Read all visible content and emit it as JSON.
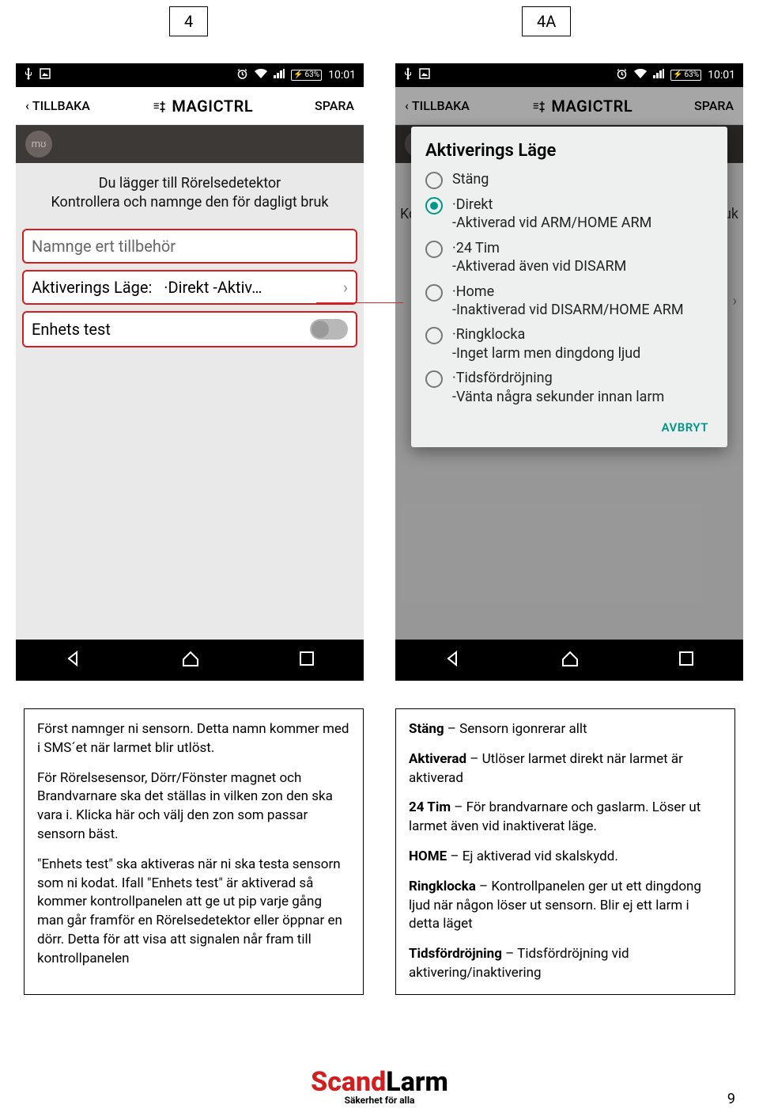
{
  "labels": {
    "left": "4",
    "right": "4A"
  },
  "status": {
    "battery_pct": "63%",
    "time": "10:01"
  },
  "header": {
    "back": "TILLBAKA",
    "brand": "MAGICTRL",
    "save": "SPARA"
  },
  "left_phone": {
    "intro_line1": "Du  lägger till Rörelsedetektor",
    "intro_line2": "Kontrollera och namnge den för dagligt bruk",
    "name_placeholder": "Namnge ert tillbehör",
    "mode_label": "Aktiverings Läge:",
    "mode_value": "·Direkt -Aktiv…",
    "device_test": "Enhets test"
  },
  "dialog": {
    "title": "Aktiverings Läge",
    "options": [
      {
        "top": "",
        "desc": "Stäng",
        "selected": false
      },
      {
        "top": "·Direkt",
        "desc": "-Aktiverad vid ARM/HOME ARM",
        "selected": true
      },
      {
        "top": "·24 Tim",
        "desc": "-Aktiverad även vid DISARM",
        "selected": false
      },
      {
        "top": "·Home",
        "desc": "-Inaktiverad vid DISARM/HOME ARM",
        "selected": false
      },
      {
        "top": "·Ringklocka",
        "desc": "-Inget larm men dingdong ljud",
        "selected": false
      },
      {
        "top": "·Tidsfördröjning",
        "desc": "-Vänta några sekunder innan larm",
        "selected": false
      }
    ],
    "cancel": "AVBRYT"
  },
  "right_peek": {
    "left_text": "Ko",
    "right_text": "uk"
  },
  "info_left": {
    "p1": "Först namnger ni sensorn. Detta namn kommer med i SMS´et när larmet blir utlöst.",
    "p2": "För Rörelsesensor, Dörr/Fönster magnet och Brandvarnare ska det ställas in vilken zon den ska vara i. Klicka här och välj den zon som passar sensorn bäst.",
    "p3": "\"Enhets test\" ska aktiveras när ni ska testa sensorn som ni kodat. Ifall \"Enhets test\" är aktiverad så kommer kontrollpanelen att ge ut pip varje gång man går framför en Rörelsedetektor eller öppnar en dörr. Detta för att visa att signalen når fram till kontrollpanelen"
  },
  "info_right": {
    "i1_k": "Stäng",
    "i1_v": " – Sensorn igonrerar allt",
    "i2_k": "Aktiverad",
    "i2_v": " – Utlöser larmet direkt när larmet är aktiverad",
    "i3_k": "24 Tim",
    "i3_v": " – För brandvarnare och gaslarm. Löser ut larmet även vid inaktiverat läge.",
    "i4_k": "HOME",
    "i4_v": " – Ej aktiverad vid skalskydd.",
    "i5_k": "Ringklocka",
    "i5_v": " – Kontrollpanelen ger ut ett dingdong ljud när någon löser ut sensorn. Blir ej ett larm i detta läget",
    "i6_k": "Tidsfördröjning",
    "i6_v": " – Tidsfördröjning vid aktivering/inaktivering"
  },
  "footer": {
    "brand1": "Scand",
    "brand2": "Larm",
    "tagline": "Säkerhet för alla"
  },
  "page_number": "9"
}
